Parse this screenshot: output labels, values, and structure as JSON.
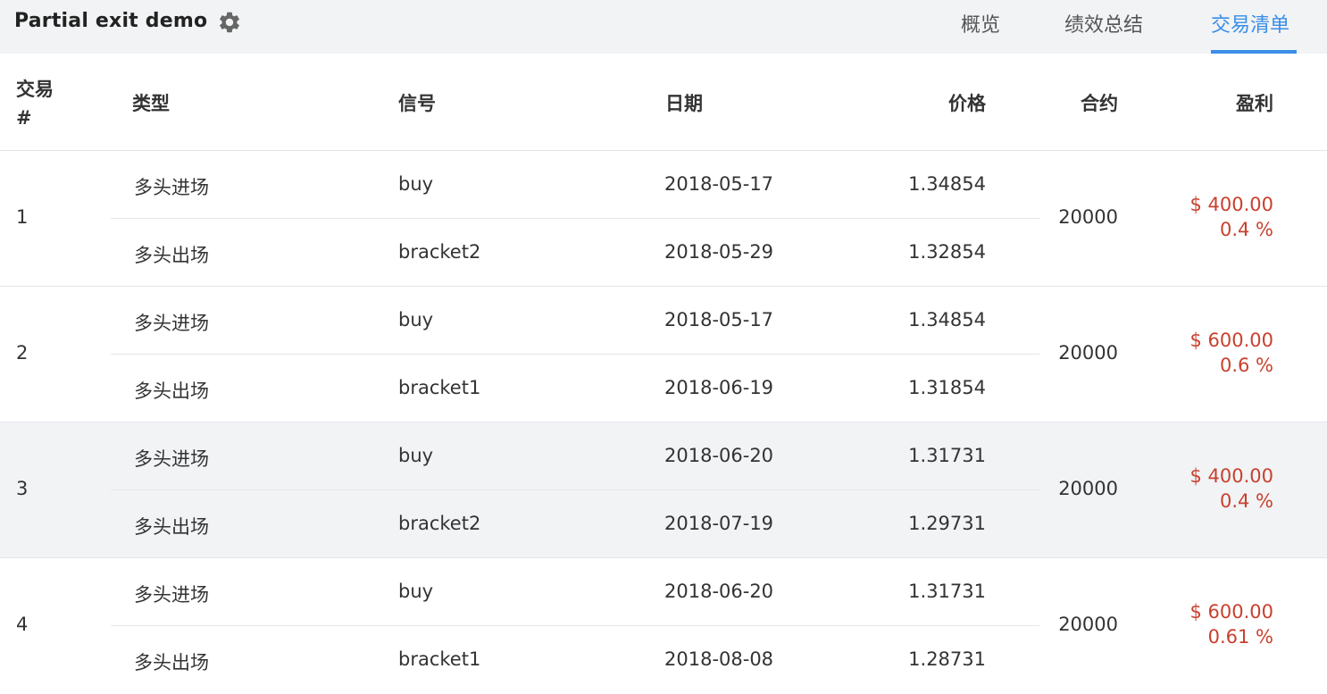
{
  "header": {
    "title": "Partial exit demo",
    "tabs": [
      {
        "label": "概览"
      },
      {
        "label": "绩效总结"
      },
      {
        "label": "交易清单"
      }
    ],
    "active_tab": "交易清单",
    "accent_color": "#3a8ee6"
  },
  "table": {
    "columns": {
      "trade_no": "交易 #",
      "type": "类型",
      "signal": "信号",
      "date": "日期",
      "price": "价格",
      "contracts": "合约",
      "profit": "盈利"
    },
    "profit_color": "#c8412e",
    "trades": [
      {
        "no": "1",
        "entry": {
          "type": "多头进场",
          "signal": "buy",
          "date": "2018-05-17",
          "price": "1.34854"
        },
        "exit": {
          "type": "多头出场",
          "signal": "bracket2",
          "date": "2018-05-29",
          "price": "1.32854"
        },
        "contracts": "20000",
        "profit": "$ 400.00",
        "profit_pct": "0.4 %"
      },
      {
        "no": "2",
        "entry": {
          "type": "多头进场",
          "signal": "buy",
          "date": "2018-05-17",
          "price": "1.34854"
        },
        "exit": {
          "type": "多头出场",
          "signal": "bracket1",
          "date": "2018-06-19",
          "price": "1.31854"
        },
        "contracts": "20000",
        "profit": "$ 600.00",
        "profit_pct": "0.6 %"
      },
      {
        "no": "3",
        "entry": {
          "type": "多头进场",
          "signal": "buy",
          "date": "2018-06-20",
          "price": "1.31731"
        },
        "exit": {
          "type": "多头出场",
          "signal": "bracket2",
          "date": "2018-07-19",
          "price": "1.29731"
        },
        "contracts": "20000",
        "profit": "$ 400.00",
        "profit_pct": "0.4 %"
      },
      {
        "no": "4",
        "entry": {
          "type": "多头进场",
          "signal": "buy",
          "date": "2018-06-20",
          "price": "1.31731"
        },
        "exit": {
          "type": "多头出场",
          "signal": "bracket1",
          "date": "2018-08-08",
          "price": "1.28731"
        },
        "contracts": "20000",
        "profit": "$ 600.00",
        "profit_pct": "0.61 %"
      }
    ]
  }
}
